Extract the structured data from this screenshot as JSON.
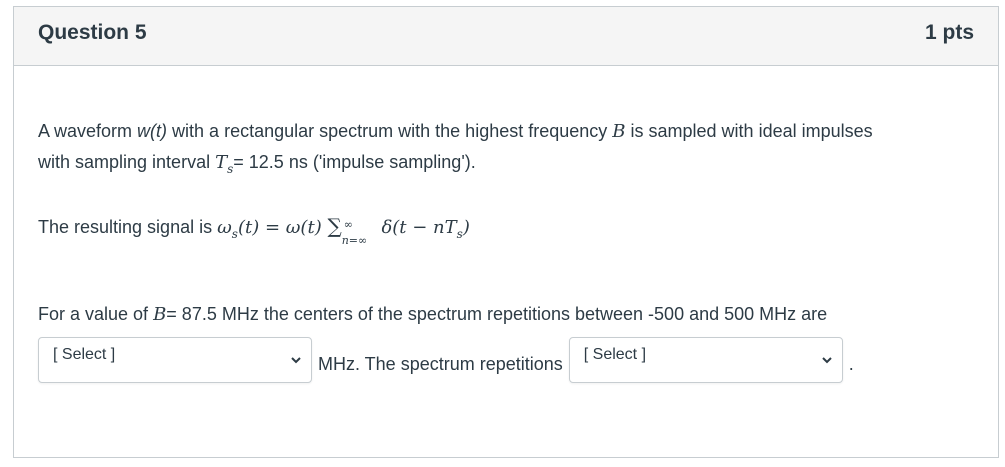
{
  "question": {
    "title": "Question 5",
    "points": "1 pts"
  },
  "body": {
    "p1_prefix": "A waveform ",
    "p1_wt": "w(t)",
    "p1_mid": " with a rectangular spectrum with the highest frequency ",
    "p1_B": "B",
    "p1_suffix": " is sampled with ideal impulses",
    "p1_line2_prefix": "with sampling interval ",
    "p1_Ts_T": "T",
    "p1_Ts_s": "s",
    "p1_line2_suffix": "= 12.5 ns ('impulse sampling').",
    "p2_prefix": "The resulting signal is ",
    "p2_omega_s": "ω",
    "p2_sub_s": "s",
    "p2_formula_mid": "(t) = ω(t) ",
    "p2_sigma": "∑",
    "p2_sup": "∞",
    "p2_sub": "n=∞",
    "p2_delta": " δ(t − nT",
    "p2_delta_sub": "s",
    "p2_close": ")",
    "p3_prefix": "For a value of ",
    "p3_B": "B",
    "p3_suffix": "= 87.5 MHz the centers of the spectrum repetitions between -500 and 500 MHz are",
    "between_text": "MHz. The spectrum repetitions",
    "end_text": "."
  },
  "selects": [
    {
      "label": "[ Select ]"
    },
    {
      "label": "[ Select ]"
    }
  ]
}
